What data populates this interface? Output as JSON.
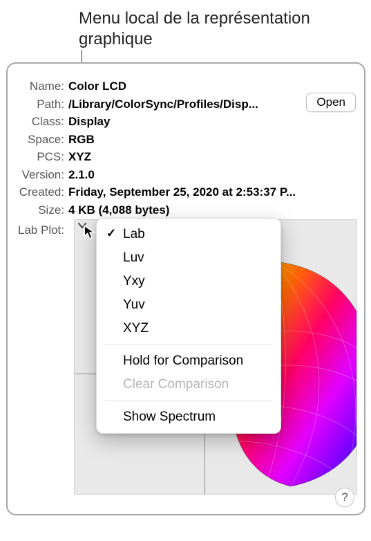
{
  "caption": "Menu local de la représentation graphique",
  "fields": {
    "name_label": "Name:",
    "name_value": "Color LCD",
    "path_label": "Path:",
    "path_value": "/Library/ColorSync/Profiles/Disp...",
    "class_label": "Class:",
    "class_value": "Display",
    "space_label": "Space:",
    "space_value": "RGB",
    "pcs_label": "PCS:",
    "pcs_value": "XYZ",
    "version_label": "Version:",
    "version_value": "2.1.0",
    "created_label": "Created:",
    "created_value": "Friday, September 25, 2020 at 2:53:37 P...",
    "size_label": "Size:",
    "size_value": "4 KB (4,088 bytes)",
    "labplot_label": "Lab Plot:"
  },
  "open_button": "Open",
  "help_button": "?",
  "menu": {
    "items": [
      "Lab",
      "Luv",
      "Yxy",
      "Yuv",
      "XYZ"
    ],
    "selected": "Lab",
    "hold": "Hold for Comparison",
    "clear": "Clear Comparison",
    "spectrum": "Show Spectrum"
  }
}
